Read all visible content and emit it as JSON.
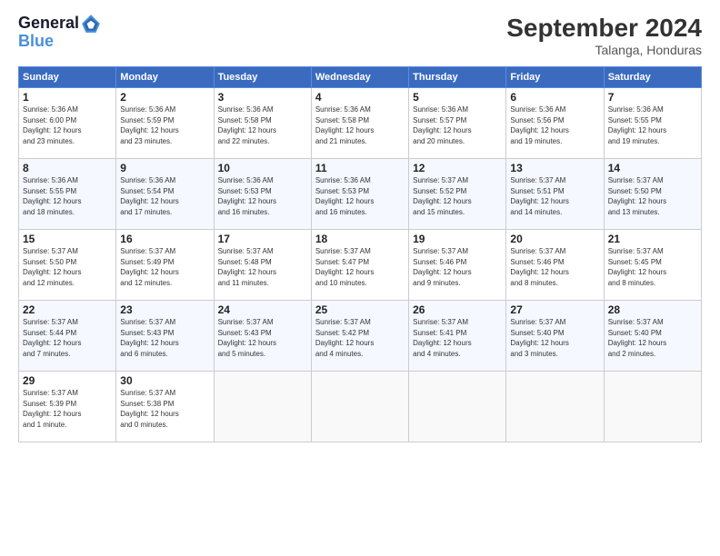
{
  "logo": {
    "line1": "General",
    "line2": "Blue"
  },
  "title": "September 2024",
  "subtitle": "Talanga, Honduras",
  "days_header": [
    "Sunday",
    "Monday",
    "Tuesday",
    "Wednesday",
    "Thursday",
    "Friday",
    "Saturday"
  ],
  "weeks": [
    [
      {
        "day": "1",
        "info": "Sunrise: 5:36 AM\nSunset: 6:00 PM\nDaylight: 12 hours\nand 23 minutes."
      },
      {
        "day": "2",
        "info": "Sunrise: 5:36 AM\nSunset: 5:59 PM\nDaylight: 12 hours\nand 23 minutes."
      },
      {
        "day": "3",
        "info": "Sunrise: 5:36 AM\nSunset: 5:58 PM\nDaylight: 12 hours\nand 22 minutes."
      },
      {
        "day": "4",
        "info": "Sunrise: 5:36 AM\nSunset: 5:58 PM\nDaylight: 12 hours\nand 21 minutes."
      },
      {
        "day": "5",
        "info": "Sunrise: 5:36 AM\nSunset: 5:57 PM\nDaylight: 12 hours\nand 20 minutes."
      },
      {
        "day": "6",
        "info": "Sunrise: 5:36 AM\nSunset: 5:56 PM\nDaylight: 12 hours\nand 19 minutes."
      },
      {
        "day": "7",
        "info": "Sunrise: 5:36 AM\nSunset: 5:55 PM\nDaylight: 12 hours\nand 19 minutes."
      }
    ],
    [
      {
        "day": "8",
        "info": "Sunrise: 5:36 AM\nSunset: 5:55 PM\nDaylight: 12 hours\nand 18 minutes."
      },
      {
        "day": "9",
        "info": "Sunrise: 5:36 AM\nSunset: 5:54 PM\nDaylight: 12 hours\nand 17 minutes."
      },
      {
        "day": "10",
        "info": "Sunrise: 5:36 AM\nSunset: 5:53 PM\nDaylight: 12 hours\nand 16 minutes."
      },
      {
        "day": "11",
        "info": "Sunrise: 5:36 AM\nSunset: 5:53 PM\nDaylight: 12 hours\nand 16 minutes."
      },
      {
        "day": "12",
        "info": "Sunrise: 5:37 AM\nSunset: 5:52 PM\nDaylight: 12 hours\nand 15 minutes."
      },
      {
        "day": "13",
        "info": "Sunrise: 5:37 AM\nSunset: 5:51 PM\nDaylight: 12 hours\nand 14 minutes."
      },
      {
        "day": "14",
        "info": "Sunrise: 5:37 AM\nSunset: 5:50 PM\nDaylight: 12 hours\nand 13 minutes."
      }
    ],
    [
      {
        "day": "15",
        "info": "Sunrise: 5:37 AM\nSunset: 5:50 PM\nDaylight: 12 hours\nand 12 minutes."
      },
      {
        "day": "16",
        "info": "Sunrise: 5:37 AM\nSunset: 5:49 PM\nDaylight: 12 hours\nand 12 minutes."
      },
      {
        "day": "17",
        "info": "Sunrise: 5:37 AM\nSunset: 5:48 PM\nDaylight: 12 hours\nand 11 minutes."
      },
      {
        "day": "18",
        "info": "Sunrise: 5:37 AM\nSunset: 5:47 PM\nDaylight: 12 hours\nand 10 minutes."
      },
      {
        "day": "19",
        "info": "Sunrise: 5:37 AM\nSunset: 5:46 PM\nDaylight: 12 hours\nand 9 minutes."
      },
      {
        "day": "20",
        "info": "Sunrise: 5:37 AM\nSunset: 5:46 PM\nDaylight: 12 hours\nand 8 minutes."
      },
      {
        "day": "21",
        "info": "Sunrise: 5:37 AM\nSunset: 5:45 PM\nDaylight: 12 hours\nand 8 minutes."
      }
    ],
    [
      {
        "day": "22",
        "info": "Sunrise: 5:37 AM\nSunset: 5:44 PM\nDaylight: 12 hours\nand 7 minutes."
      },
      {
        "day": "23",
        "info": "Sunrise: 5:37 AM\nSunset: 5:43 PM\nDaylight: 12 hours\nand 6 minutes."
      },
      {
        "day": "24",
        "info": "Sunrise: 5:37 AM\nSunset: 5:43 PM\nDaylight: 12 hours\nand 5 minutes."
      },
      {
        "day": "25",
        "info": "Sunrise: 5:37 AM\nSunset: 5:42 PM\nDaylight: 12 hours\nand 4 minutes."
      },
      {
        "day": "26",
        "info": "Sunrise: 5:37 AM\nSunset: 5:41 PM\nDaylight: 12 hours\nand 4 minutes."
      },
      {
        "day": "27",
        "info": "Sunrise: 5:37 AM\nSunset: 5:40 PM\nDaylight: 12 hours\nand 3 minutes."
      },
      {
        "day": "28",
        "info": "Sunrise: 5:37 AM\nSunset: 5:40 PM\nDaylight: 12 hours\nand 2 minutes."
      }
    ],
    [
      {
        "day": "29",
        "info": "Sunrise: 5:37 AM\nSunset: 5:39 PM\nDaylight: 12 hours\nand 1 minute."
      },
      {
        "day": "30",
        "info": "Sunrise: 5:37 AM\nSunset: 5:38 PM\nDaylight: 12 hours\nand 0 minutes."
      },
      {
        "day": "",
        "info": ""
      },
      {
        "day": "",
        "info": ""
      },
      {
        "day": "",
        "info": ""
      },
      {
        "day": "",
        "info": ""
      },
      {
        "day": "",
        "info": ""
      }
    ]
  ]
}
